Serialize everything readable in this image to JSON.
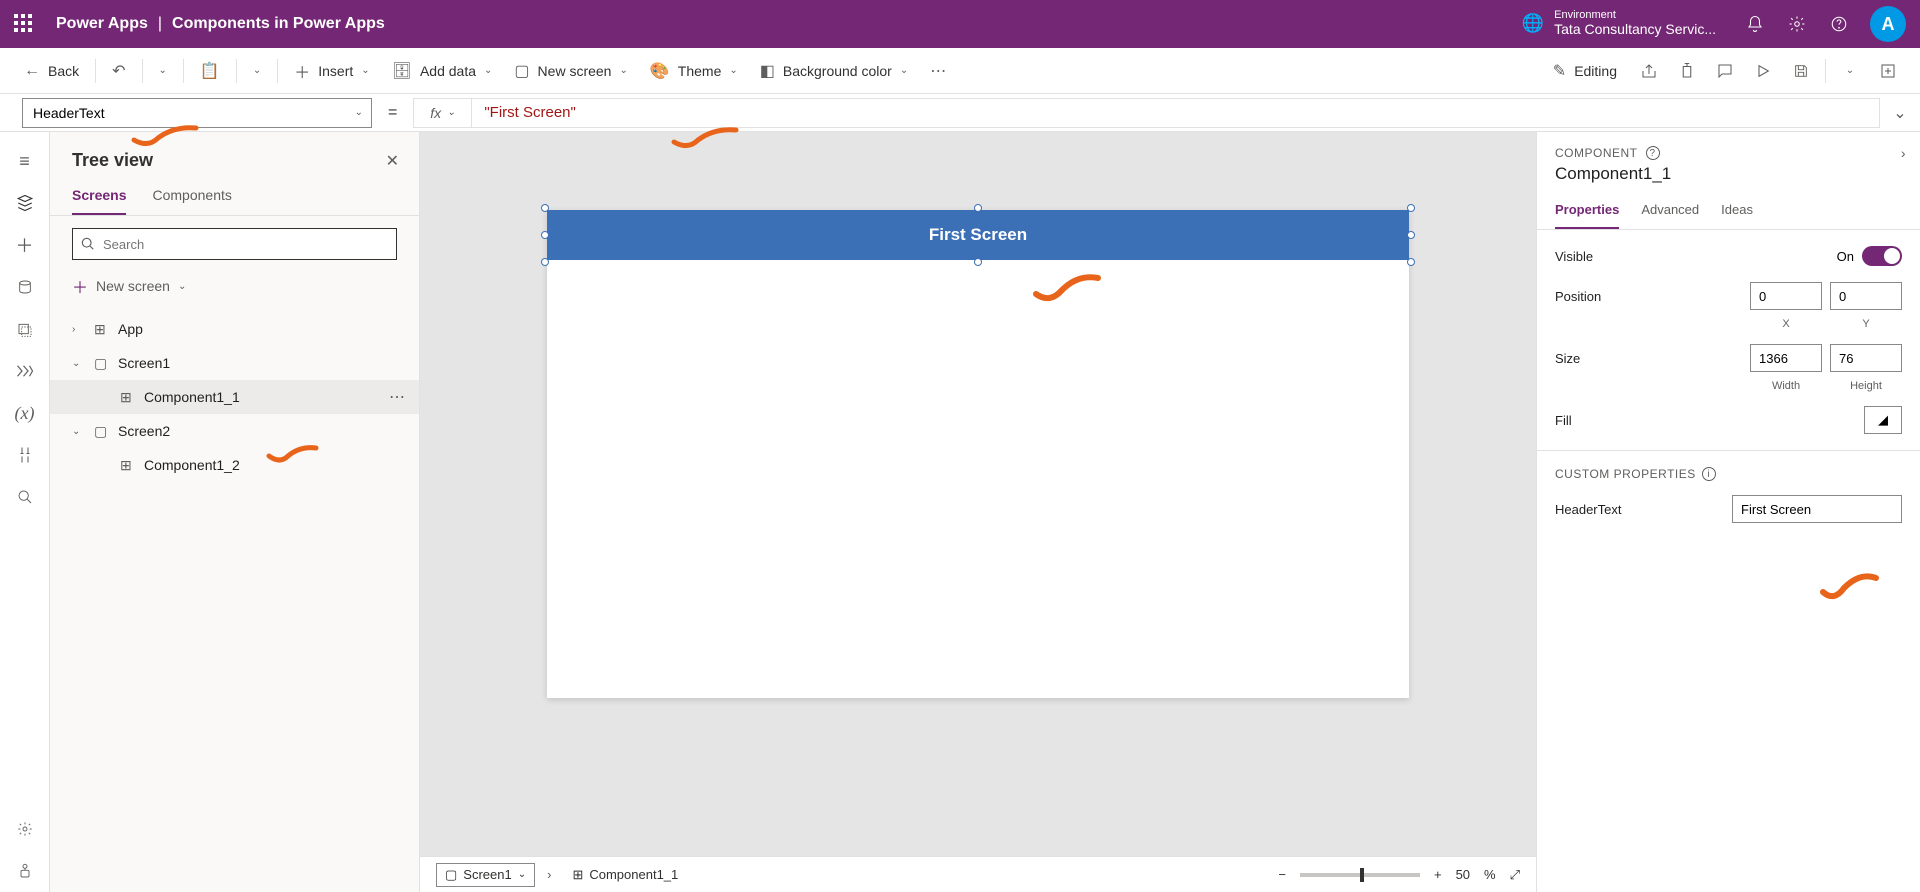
{
  "topbar": {
    "brand": "Power Apps",
    "divider": "|",
    "app_title": "Components in Power Apps",
    "env_label": "Environment",
    "env_name": "Tata Consultancy Servic...",
    "avatar_initial": "A"
  },
  "ribbon": {
    "back": "Back",
    "insert": "Insert",
    "add_data": "Add data",
    "new_screen": "New screen",
    "theme": "Theme",
    "bg_color": "Background color",
    "editing": "Editing"
  },
  "formula": {
    "property": "HeaderText",
    "equals": "=",
    "fx_label": "fx",
    "value": "\"First Screen\""
  },
  "tree": {
    "title": "Tree view",
    "tabs": {
      "screens": "Screens",
      "components": "Components"
    },
    "search_placeholder": "Search",
    "new_screen": "New screen",
    "nodes": {
      "app": "App",
      "screen1": "Screen1",
      "component1_1": "Component1_1",
      "screen2": "Screen2",
      "component1_2": "Component1_2"
    }
  },
  "canvas": {
    "header_text": "First Screen"
  },
  "status": {
    "screen": "Screen1",
    "component": "Component1_1",
    "zoom_value": "50",
    "zoom_unit": "%"
  },
  "props": {
    "section": "COMPONENT",
    "instance": "Component1_1",
    "tabs": {
      "properties": "Properties",
      "advanced": "Advanced",
      "ideas": "Ideas"
    },
    "visible_label": "Visible",
    "visible_value": "On",
    "position_label": "Position",
    "pos_x": "0",
    "pos_y": "0",
    "xlabel": "X",
    "ylabel": "Y",
    "size_label": "Size",
    "width": "1366",
    "height": "76",
    "wlabel": "Width",
    "hlabel": "Height",
    "fill_label": "Fill",
    "custom_section": "CUSTOM PROPERTIES",
    "headertext_label": "HeaderText",
    "headertext_value": "First Screen"
  }
}
